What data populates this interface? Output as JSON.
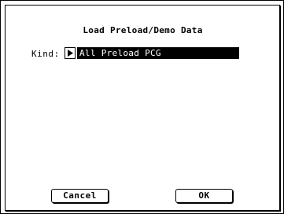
{
  "dialog": {
    "title": "Load Preload/Demo Data",
    "kind_label": "Kind:",
    "kind_value": "All Preload PCG",
    "kind_arrow_icon": "triangle-right-icon"
  },
  "buttons": {
    "cancel_label": "Cancel",
    "ok_label": "OK"
  }
}
